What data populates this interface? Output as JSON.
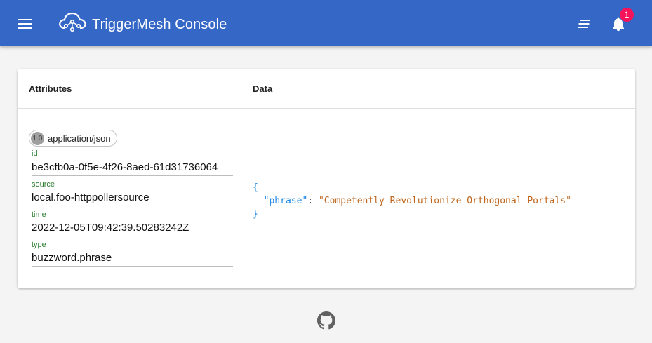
{
  "header": {
    "title": "TriggerMesh Console",
    "notification_count": "1",
    "bg_color": "#3567c7",
    "menu_icon": "hamburger-menu-icon",
    "logo_icon": "cloud-network-logo-icon",
    "list_icon": "sort-list-icon",
    "bell_icon": "bell-icon"
  },
  "table": {
    "col_attributes": "Attributes",
    "col_data": "Data"
  },
  "event": {
    "spec_version": "1.0",
    "content_type": "application/json",
    "attributes": [
      {
        "label": "id",
        "value": "be3cfb0a-0f5e-4f26-8aed-61d31736064"
      },
      {
        "label": "source",
        "value": "local.foo-httppollersource"
      },
      {
        "label": "time",
        "value": "2022-12-05T09:42:39.50283242Z"
      },
      {
        "label": "type",
        "value": "buzzword.phrase"
      }
    ],
    "data": {
      "open": "{",
      "key": "\"phrase\"",
      "colon": ": ",
      "value": "\"Competently Revolutionize Orthogonal Portals\"",
      "close": "}"
    }
  },
  "footer": {
    "github_icon": "github-icon"
  }
}
